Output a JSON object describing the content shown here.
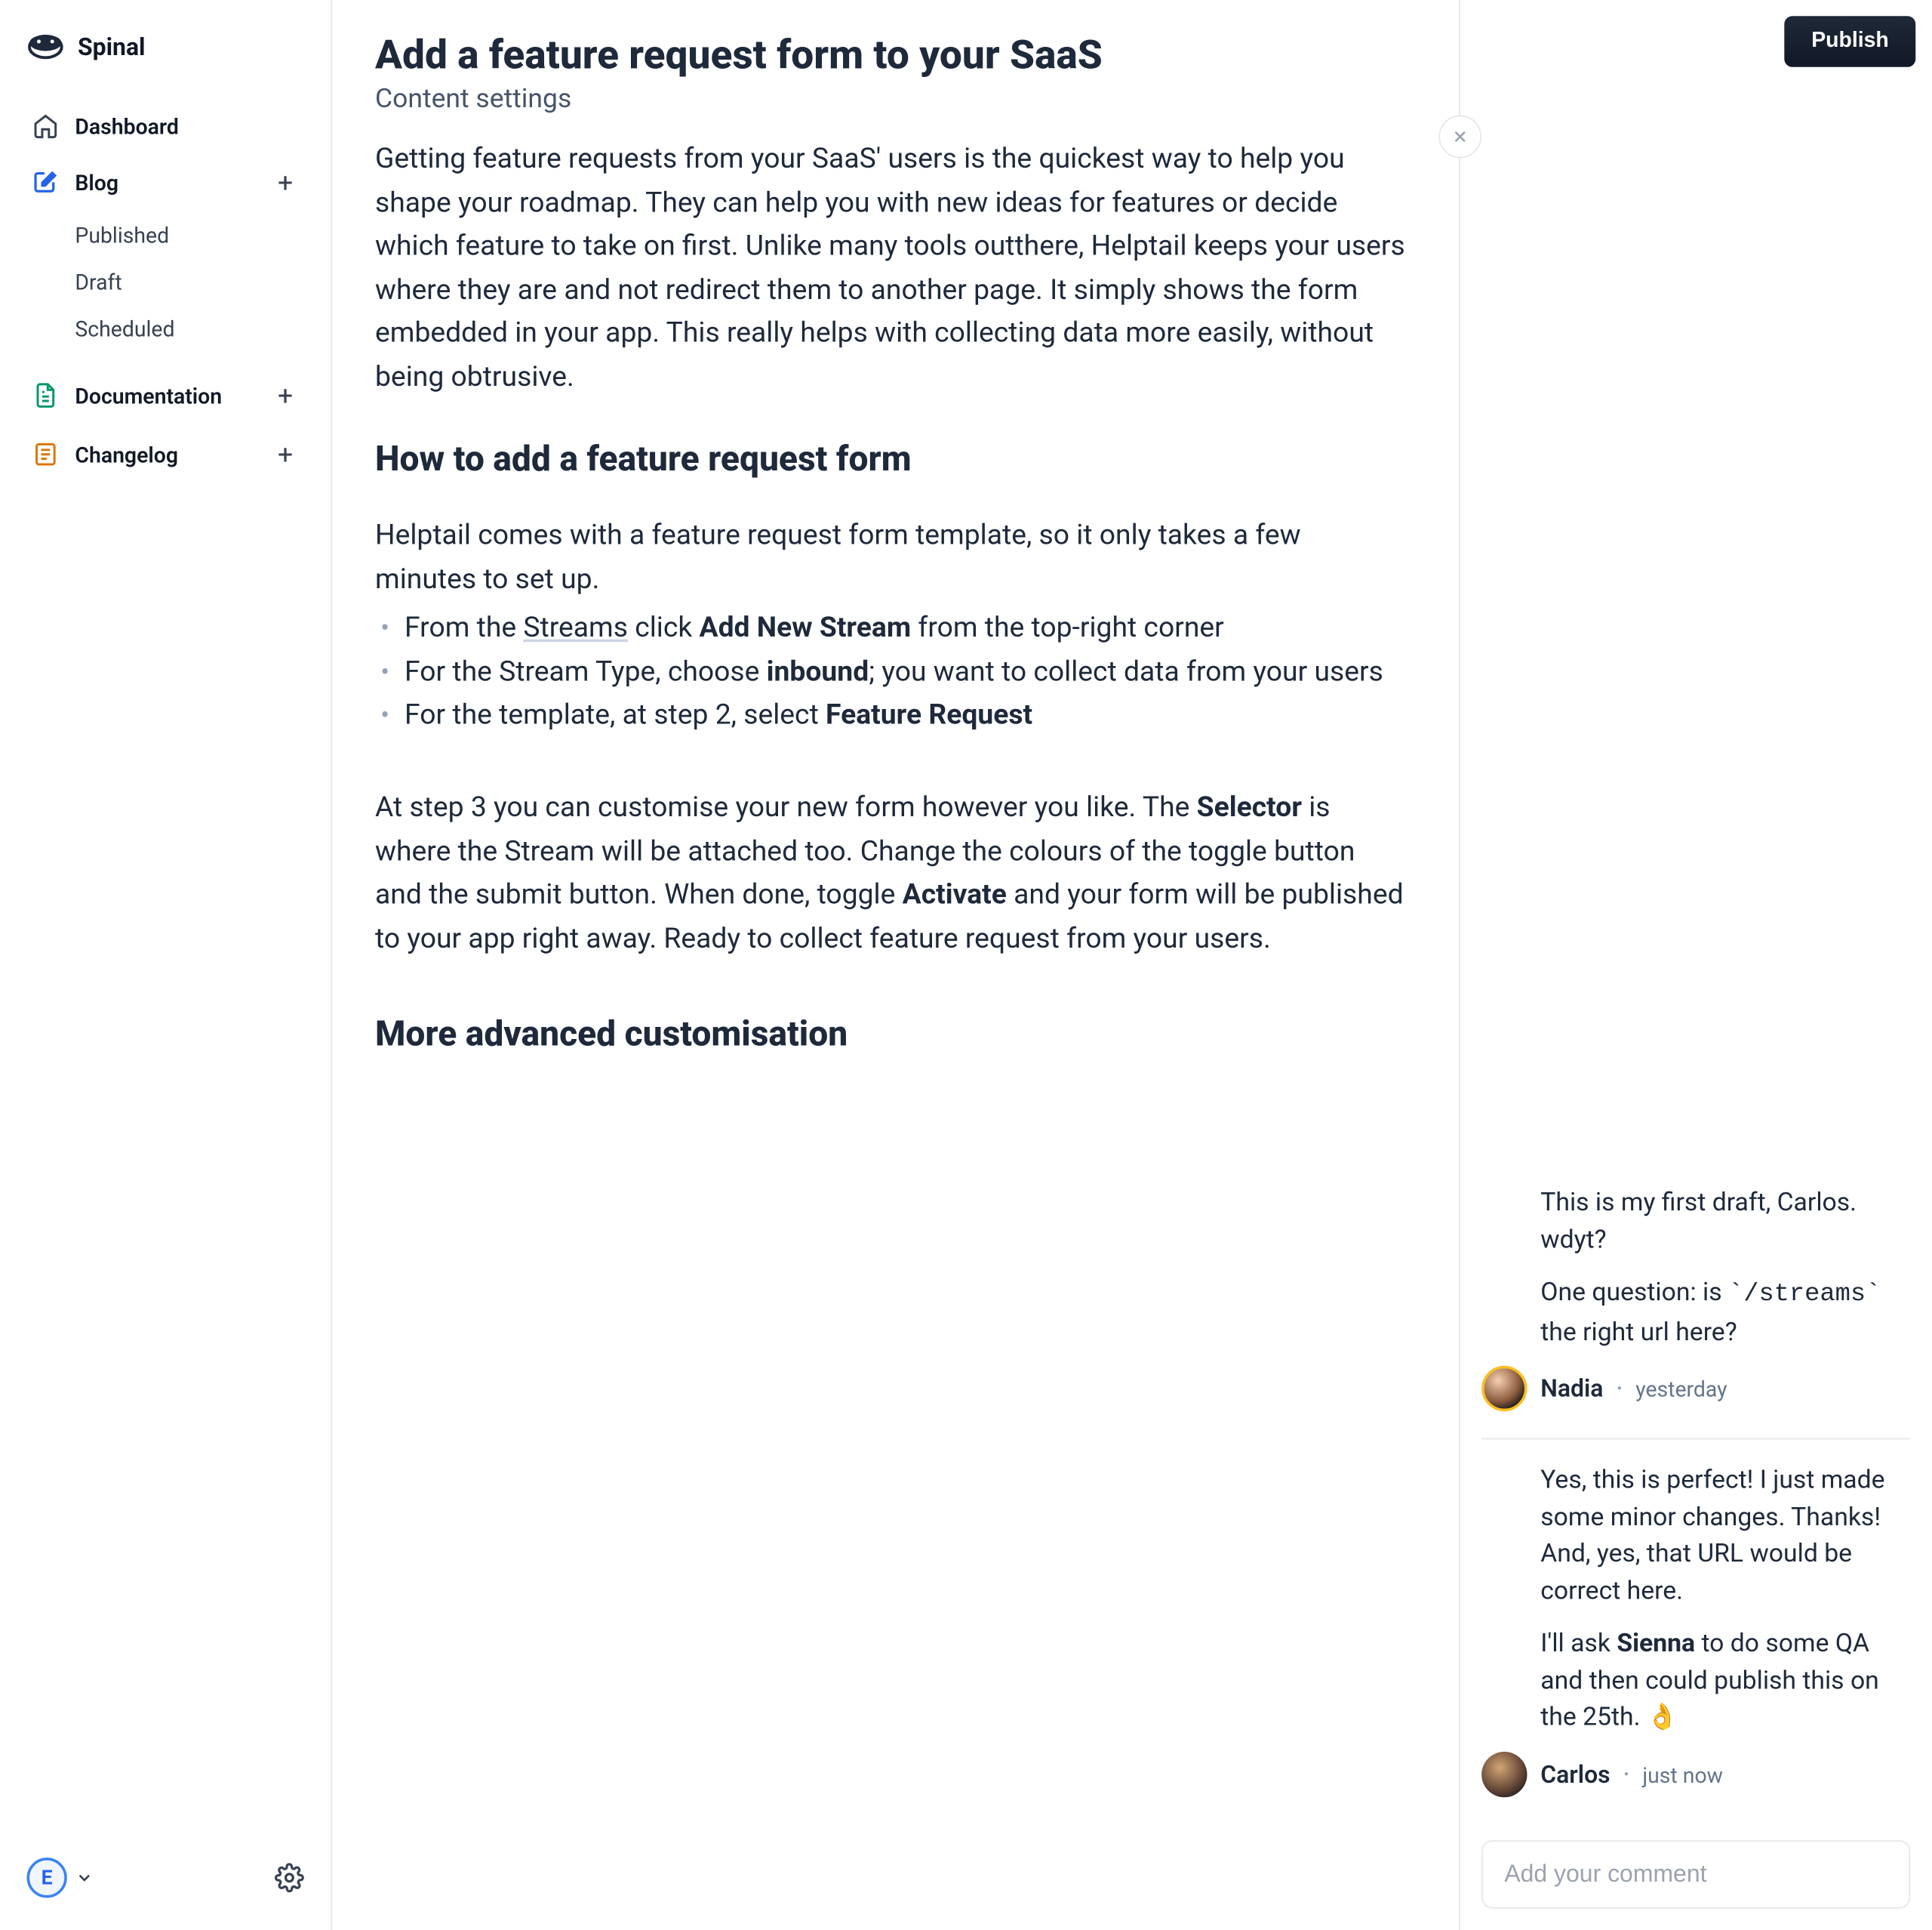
{
  "brand": "Spinal",
  "sidebar": {
    "dashboard": "Dashboard",
    "blog": "Blog",
    "blog_children": {
      "published": "Published",
      "draft": "Draft",
      "scheduled": "Scheduled"
    },
    "documentation": "Documentation",
    "changelog": "Changelog",
    "avatar_initial": "E"
  },
  "article": {
    "title": "Add a feature request form to your SaaS",
    "subtitle": "Content settings",
    "p1": "Getting feature requests from your SaaS' users is the quickest way to help you shape your roadmap. They can help you with new ideas for features or decide which feature to take on first. Unlike many tools outthere, Helptail keeps your users where they are and not redirect them to another page. It simply shows the form embedded in your app. This really helps with collecting data more easily, without being obtrusive.",
    "h2a": "How to add a feature request form",
    "p2": "Helptail comes with a feature request form template, so it only takes a few minutes to set up.",
    "bullet1": {
      "pre": "From the ",
      "link": "Streams",
      "mid": " click ",
      "bold": "Add New Stream",
      "post": " from the top-right corner"
    },
    "bullet2": {
      "pre": "For the Stream Type, choose ",
      "bold": "inbound",
      "post": "; you want to collect data from your users"
    },
    "bullet3": {
      "pre": "For the template, at step 2, select ",
      "bold": "Feature Request"
    },
    "p3_pre": "At step 3 you can customise your new form however you like. The ",
    "p3_bold1": "Selector",
    "p3_mid": " is where the Stream will be attached too. Change the colours of the toggle button and the submit button. When done, toggle ",
    "p3_bold2": "Activate",
    "p3_post": " and your form will be published to your app right away. Ready to collect feature request from your users.",
    "h2b": "More advanced customisation"
  },
  "publish_label": "Publish",
  "comments": {
    "c1": {
      "body_p1": "This is my first draft, Carlos. wdyt?",
      "body_p2_pre": "One question: is ",
      "body_p2_code": "`/streams`",
      "body_p2_post": " the right url here?",
      "author": "Nadia",
      "time": "yesterday"
    },
    "c2": {
      "body_p1": "Yes, this is perfect! I just made some minor changes. Thanks! And, yes, that URL would be correct here.",
      "body_p2_pre": "I'll ask ",
      "body_p2_mention": "Sienna",
      "body_p2_post": " to do some QA and then could publish this on the 25th. 👌",
      "author": "Carlos",
      "time": "just now"
    },
    "input_placeholder": "Add your comment"
  }
}
